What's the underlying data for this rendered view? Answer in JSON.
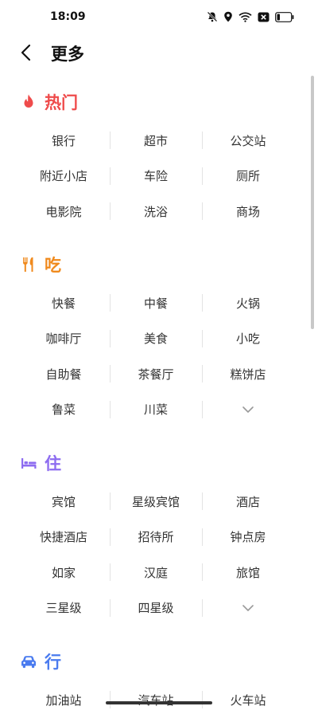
{
  "status": {
    "time": "18:09"
  },
  "header": {
    "title": "更多"
  },
  "sections": [
    {
      "title": "热门",
      "color": "#ef4b4b",
      "icon": "fire-icon",
      "rows": [
        [
          "银行",
          "超市",
          "公交站"
        ],
        [
          "附近小店",
          "车险",
          "厕所"
        ],
        [
          "电影院",
          "洗浴",
          "商场"
        ]
      ]
    },
    {
      "title": "吃",
      "color": "#f08a1d",
      "icon": "fork-knife-icon",
      "rows": [
        [
          "快餐",
          "中餐",
          "火锅"
        ],
        [
          "咖啡厅",
          "美食",
          "小吃"
        ],
        [
          "自助餐",
          "茶餐厅",
          "糕饼店"
        ],
        [
          "鲁菜",
          "川菜",
          ""
        ]
      ]
    },
    {
      "title": "住",
      "color": "#8d6cf0",
      "icon": "bed-icon",
      "rows": [
        [
          "宾馆",
          "星级宾馆",
          "酒店"
        ],
        [
          "快捷酒店",
          "招待所",
          "钟点房"
        ],
        [
          "如家",
          "汉庭",
          "旅馆"
        ],
        [
          "三星级",
          "四星级",
          ""
        ]
      ]
    },
    {
      "title": "行",
      "color": "#4a7bef",
      "icon": "car-icon",
      "rows": [
        [
          "加油站",
          "汽车站",
          "火车站"
        ]
      ]
    }
  ]
}
